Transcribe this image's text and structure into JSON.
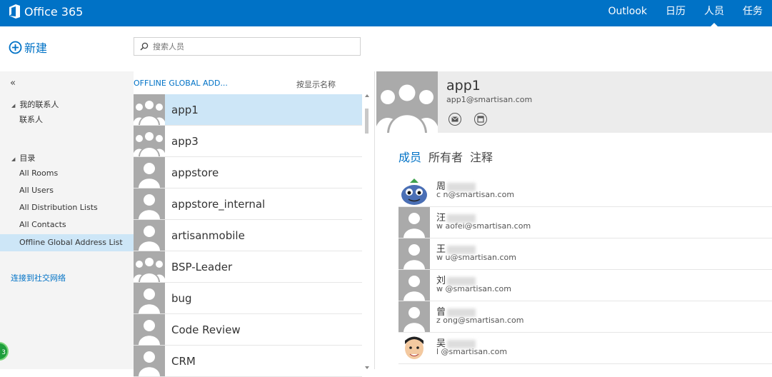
{
  "app": {
    "title": "Office 365"
  },
  "nav": [
    {
      "label": "Outlook",
      "active": false
    },
    {
      "label": "日历",
      "active": false
    },
    {
      "label": "人员",
      "active": true
    },
    {
      "label": "任务",
      "active": false
    }
  ],
  "new_label": "新建",
  "search": {
    "placeholder": "搜索人员"
  },
  "sidebar": {
    "collapse": "«",
    "my_contacts": "我的联系人",
    "contacts": "联系人",
    "directory": "目录",
    "items": [
      "All Rooms",
      "All Users",
      "All Distribution Lists",
      "All Contacts",
      "Offline Global Address List"
    ],
    "social_link": "连接到社交网络"
  },
  "badge": {
    "text": "3"
  },
  "list": {
    "header": "OFFLINE GLOBAL ADD...",
    "sort_label": "按显示名称",
    "rows": [
      {
        "name": "app1",
        "group": true
      },
      {
        "name": "app3",
        "group": true
      },
      {
        "name": "appstore",
        "group": false
      },
      {
        "name": "appstore_internal",
        "group": false
      },
      {
        "name": "artisanmobile",
        "group": false
      },
      {
        "name": "BSP-Leader",
        "group": true
      },
      {
        "name": "bug",
        "group": false
      },
      {
        "name": "Code Review",
        "group": false
      },
      {
        "name": "CRM",
        "group": false
      }
    ]
  },
  "detail": {
    "name": "app1",
    "email": "app1@smartisan.com",
    "tabs": [
      "成员",
      "所有者",
      "注释"
    ],
    "members": [
      {
        "name": "周",
        "email": "c    n@smartisan.com",
        "avatar": "monster"
      },
      {
        "name": "汪",
        "email": "w    aofei@smartisan.com",
        "avatar": "default"
      },
      {
        "name": "王",
        "email": "w    u@smartisan.com",
        "avatar": "default"
      },
      {
        "name": "刘",
        "email": "w    @smartisan.com",
        "avatar": "default"
      },
      {
        "name": "曾",
        "email": "z    ong@smartisan.com",
        "avatar": "default"
      },
      {
        "name": "吴",
        "email": "l    @smartisan.com",
        "avatar": "face"
      }
    ]
  },
  "colors": {
    "accent": "#0072c6",
    "selected": "#cde6f7"
  }
}
